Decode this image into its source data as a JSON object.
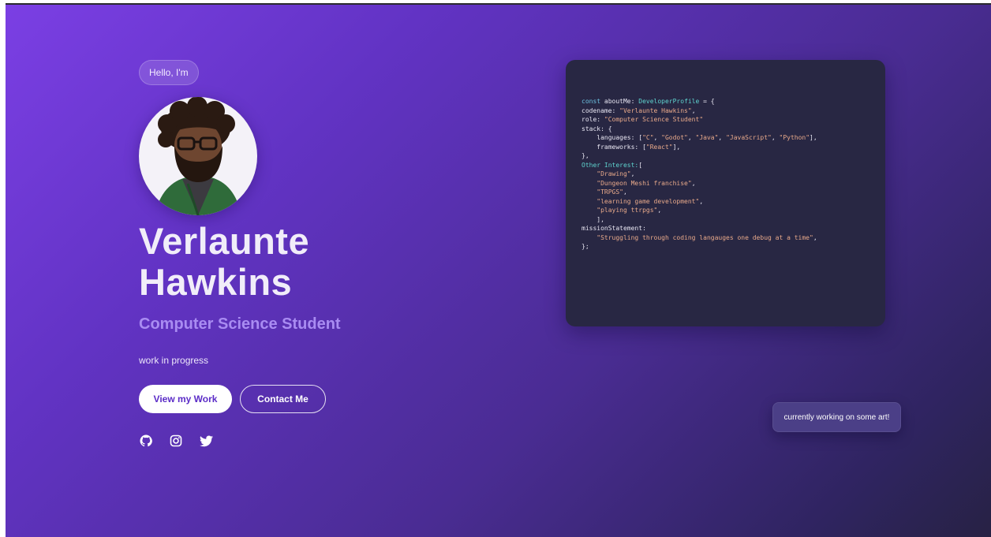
{
  "hero": {
    "greeting": "Hello, I'm",
    "name_line1": "Verlaunte",
    "name_line2": "Hawkins",
    "role": "Computer Science Student",
    "tagline": "work in progress"
  },
  "actions": {
    "primary_label": "View my Work",
    "secondary_label": "Contact Me"
  },
  "socials": [
    {
      "icon": "github-icon"
    },
    {
      "icon": "instagram-icon"
    },
    {
      "icon": "twitter-icon"
    }
  ],
  "code": {
    "lines": [
      [
        {
          "t": "const ",
          "c": "kw"
        },
        {
          "t": "aboutMe: ",
          "c": ""
        },
        {
          "t": "DeveloperProfile",
          "c": "ty"
        },
        {
          "t": " = {",
          "c": ""
        }
      ],
      [
        {
          "t": "codename: ",
          "c": ""
        },
        {
          "t": "\"Verlaunte Hawkins\"",
          "c": "str"
        },
        {
          "t": ",",
          "c": ""
        }
      ],
      [
        {
          "t": "role: ",
          "c": ""
        },
        {
          "t": "\"Computer Science Student\"",
          "c": "str"
        }
      ],
      [
        {
          "t": "stack: {",
          "c": ""
        }
      ],
      [
        {
          "t": "    languages: [",
          "c": ""
        },
        {
          "t": "\"C\"",
          "c": "str"
        },
        {
          "t": ", ",
          "c": ""
        },
        {
          "t": "\"Godot\"",
          "c": "str"
        },
        {
          "t": ", ",
          "c": ""
        },
        {
          "t": "\"Java\"",
          "c": "str"
        },
        {
          "t": ", ",
          "c": ""
        },
        {
          "t": "\"JavaScript\"",
          "c": "str"
        },
        {
          "t": ", ",
          "c": ""
        },
        {
          "t": "\"Python\"",
          "c": "str"
        },
        {
          "t": "],",
          "c": ""
        }
      ],
      [
        {
          "t": "    frameworks: [",
          "c": ""
        },
        {
          "t": "\"React\"",
          "c": "str"
        },
        {
          "t": "],",
          "c": ""
        }
      ],
      [
        {
          "t": "},",
          "c": ""
        }
      ],
      [
        {
          "t": "Other Interest:",
          "c": "ty"
        },
        {
          "t": "[",
          "c": ""
        }
      ],
      [
        {
          "t": "    \"Drawing\"",
          "c": "str"
        },
        {
          "t": ",",
          "c": ""
        }
      ],
      [
        {
          "t": "    \"Dungeon Meshi franchise\"",
          "c": "str"
        },
        {
          "t": ",",
          "c": ""
        }
      ],
      [
        {
          "t": "    \"TRPGS\"",
          "c": "str"
        },
        {
          "t": ",",
          "c": ""
        }
      ],
      [
        {
          "t": "    \"learning game development\"",
          "c": "str"
        },
        {
          "t": ",",
          "c": ""
        }
      ],
      [
        {
          "t": "    \"playing ttrpgs\"",
          "c": "str"
        },
        {
          "t": ",",
          "c": ""
        }
      ],
      [
        {
          "t": "    ],",
          "c": ""
        }
      ],
      [
        {
          "t": "missionStatement:",
          "c": ""
        }
      ],
      [
        {
          "t": "    \"Struggling through coding langauges one debug at a time\"",
          "c": "str"
        },
        {
          "t": ",",
          "c": ""
        }
      ],
      [
        {
          "t": "};",
          "c": ""
        }
      ]
    ]
  },
  "toast": {
    "message": "currently working on some art!"
  },
  "colors": {
    "accent": "#a98cf2",
    "button_text": "#5b2cc7",
    "code_bg": "#282743",
    "keyword": "#6cc1e0",
    "type": "#5fd4cf",
    "string": "#e8a98a"
  }
}
